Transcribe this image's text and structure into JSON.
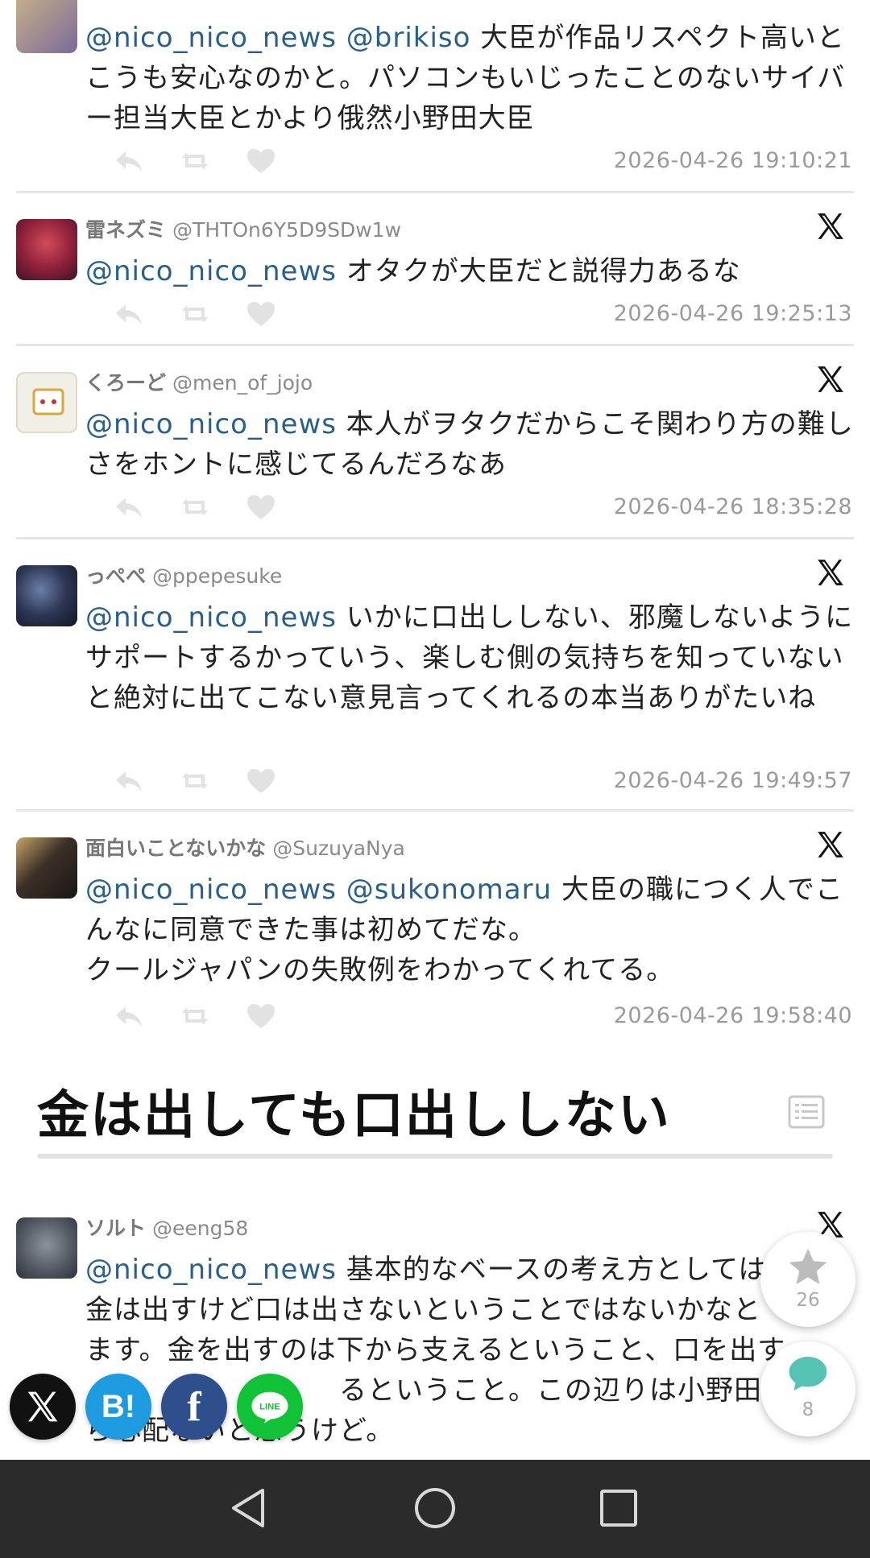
{
  "tweets": [
    {
      "name": "",
      "handle": "",
      "mentions": "@nico_nico_news @brikiso",
      "text": " 大臣が作品リスペクト高いとこうも安心なのかと。パソコンもいじったことのないサイバー担当大臣とかより俄然小野田大臣",
      "time": "2026-04-26 19:10:21"
    },
    {
      "name": "雷ネズミ",
      "handle": "@THTOn6Y5D9SDw1w",
      "mentions": "@nico_nico_news",
      "text": " オタクが大臣だと説得力あるな",
      "time": "2026-04-26 19:25:13"
    },
    {
      "name": "くろーど",
      "handle": "@men_of_jojo",
      "mentions": "@nico_nico_news",
      "text": " 本人がヲタクだからこそ関わり方の難しさをホントに感じてるんだろなあ",
      "time": "2026-04-26 18:35:28"
    },
    {
      "name": "っぺぺ",
      "handle": "@ppepesuke",
      "mentions": "@nico_nico_news",
      "text": " いかに口出ししない、邪魔しないようにサポートするかっていう、楽しむ側の気持ちを知っていないと絶対に出てこない意見言ってくれるの本当ありがたいね",
      "time": "2026-04-26 19:49:57"
    },
    {
      "name": "面白いことないかな",
      "handle": "@SuzuyaNya",
      "mentions": "@nico_nico_news @sukonomaru",
      "text": " 大臣の職につく人でこんなに同意できた事は初めてだな。\nクールジャパンの失敗例をわかってくれてる。",
      "time": "2026-04-26 19:58:40"
    }
  ],
  "section": {
    "title": "金は出しても口出ししない"
  },
  "last_tweet": {
    "name": "ソルト",
    "handle": "@eeng58",
    "mentions": "@nico_nico_news",
    "text": " 基本的なベースの考え方としてはや\n金は出すけど口は出さないということではないかなと\nます。金を出すのは下から支えるということ、口を出す\n　　　　　　　　　るということ。この辺りは小野田こ\nら心配ないと思うけど。"
  },
  "floating": {
    "favorite_count": "26",
    "comment_count": "8"
  },
  "share_buttons": {
    "hatena": "B!",
    "facebook": "f",
    "line": "LINE"
  }
}
